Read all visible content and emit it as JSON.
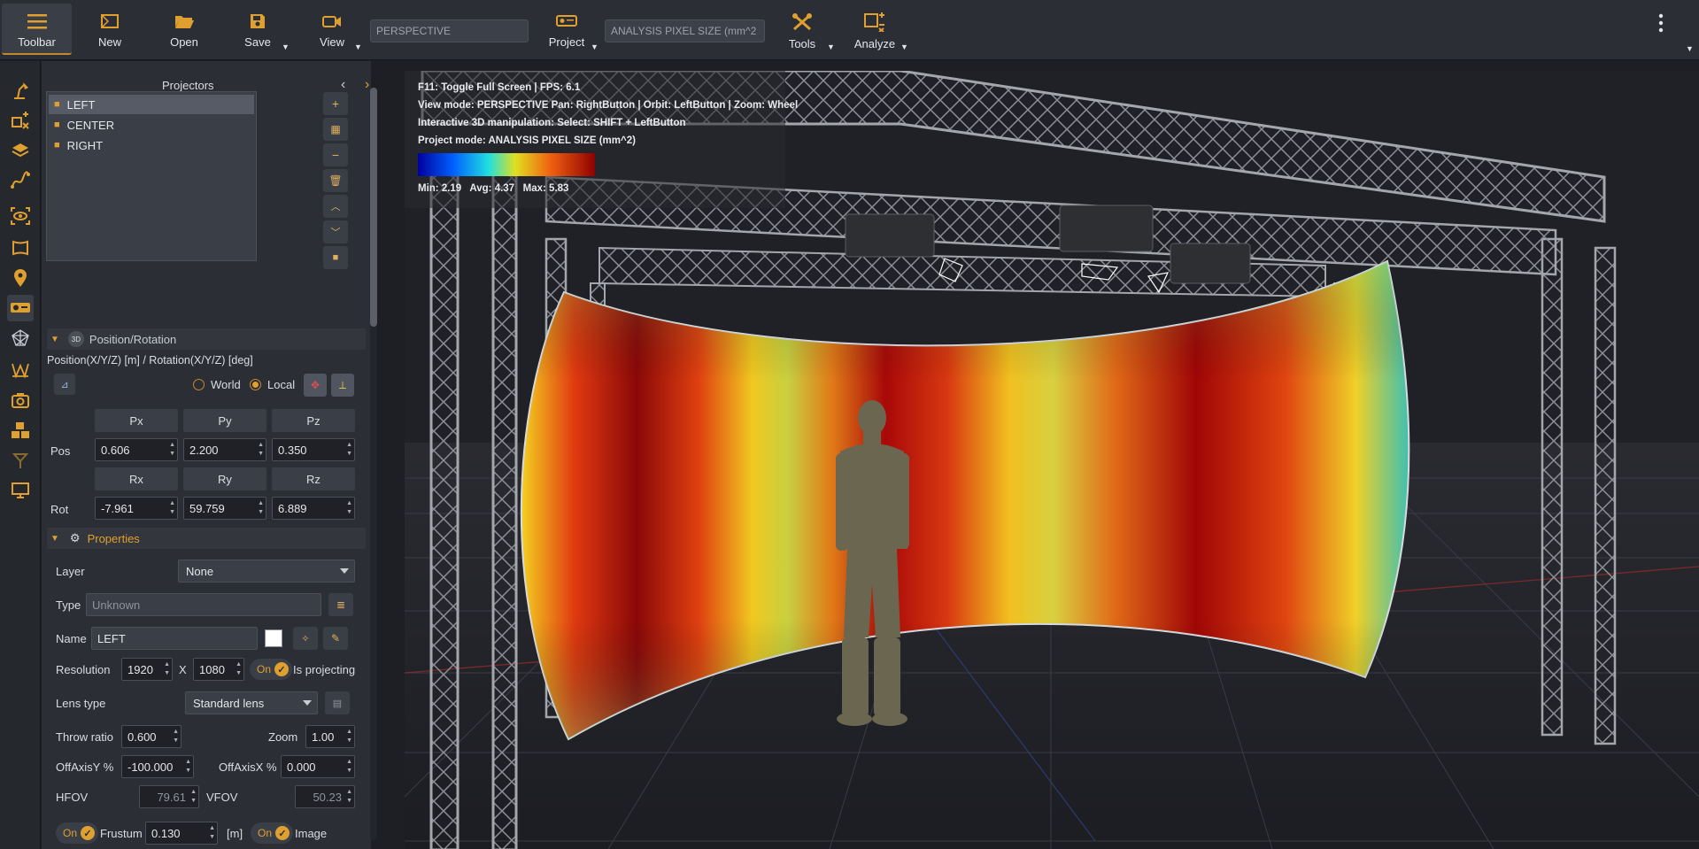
{
  "toolbar": {
    "toolbar_label": "Toolbar",
    "new_label": "New",
    "open_label": "Open",
    "save_label": "Save",
    "view_label": "View",
    "view_mode_field": "PERSPECTIVE",
    "project_label": "Project",
    "project_mode_field": "ANALYSIS PIXEL SIZE (mm^2",
    "tools_label": "Tools",
    "analyze_label": "Analyze"
  },
  "panel": {
    "title": "Projectors",
    "projectors": [
      "LEFT",
      "CENTER",
      "RIGHT"
    ],
    "position_section": "Position/Rotation",
    "position_caption": "Position(X/Y/Z) [m] / Rotation(X/Y/Z) [deg]",
    "world_label": "World",
    "local_label": "Local",
    "coord_mode": "Local",
    "pos_headers": [
      "Px",
      "Py",
      "Pz"
    ],
    "pos_label": "Pos",
    "pos_values": [
      "0.606",
      "2.200",
      "0.350"
    ],
    "rot_headers": [
      "Rx",
      "Ry",
      "Rz"
    ],
    "rot_label": "Rot",
    "rot_values": [
      "-7.961",
      "59.759",
      "6.889"
    ],
    "properties_section": "Properties",
    "layer_label": "Layer",
    "layer_value": "None",
    "type_label": "Type",
    "type_placeholder": "Unknown",
    "name_label": "Name",
    "name_value": "LEFT",
    "resolution_label": "Resolution",
    "res_w": "1920",
    "res_x": "X",
    "res_h": "1080",
    "toggle_on": "On",
    "is_projecting_label": "Is projecting",
    "lens_type_label": "Lens type",
    "lens_type_value": "Standard lens",
    "throw_ratio_label": "Throw ratio",
    "throw_ratio_value": "0.600",
    "zoom_label": "Zoom",
    "zoom_value": "1.00",
    "offaxis_y_label": "OffAxisY %",
    "offaxis_y_value": "-100.000",
    "offaxis_x_label": "OffAxisX %",
    "offaxis_x_value": "0.000",
    "hfov_label": "HFOV",
    "hfov_value": "79.61",
    "vfov_label": "VFOV",
    "vfov_value": "50.23",
    "frustum_label": "Frustum",
    "frustum_value": "0.130",
    "frustum_unit": "[m]",
    "image_label": "Image"
  },
  "viewport": {
    "line1": "F11: Toggle Full Screen | FPS: 6.1",
    "line2": "View mode: PERSPECTIVE Pan: RightButton | Orbit: LeftButton | Zoom: Wheel",
    "line3": "Interactive 3D manipulation: Select: SHIFT + LeftButton",
    "line4": "Project mode: ANALYSIS PIXEL SIZE (mm^2)",
    "legend_text": "Min: 2.19   Avg: 4.37   Max: 5.83"
  },
  "colors": {
    "accent": "#e0a030",
    "panel_bg": "#2b2e34",
    "viewport_bg": "#222329"
  }
}
